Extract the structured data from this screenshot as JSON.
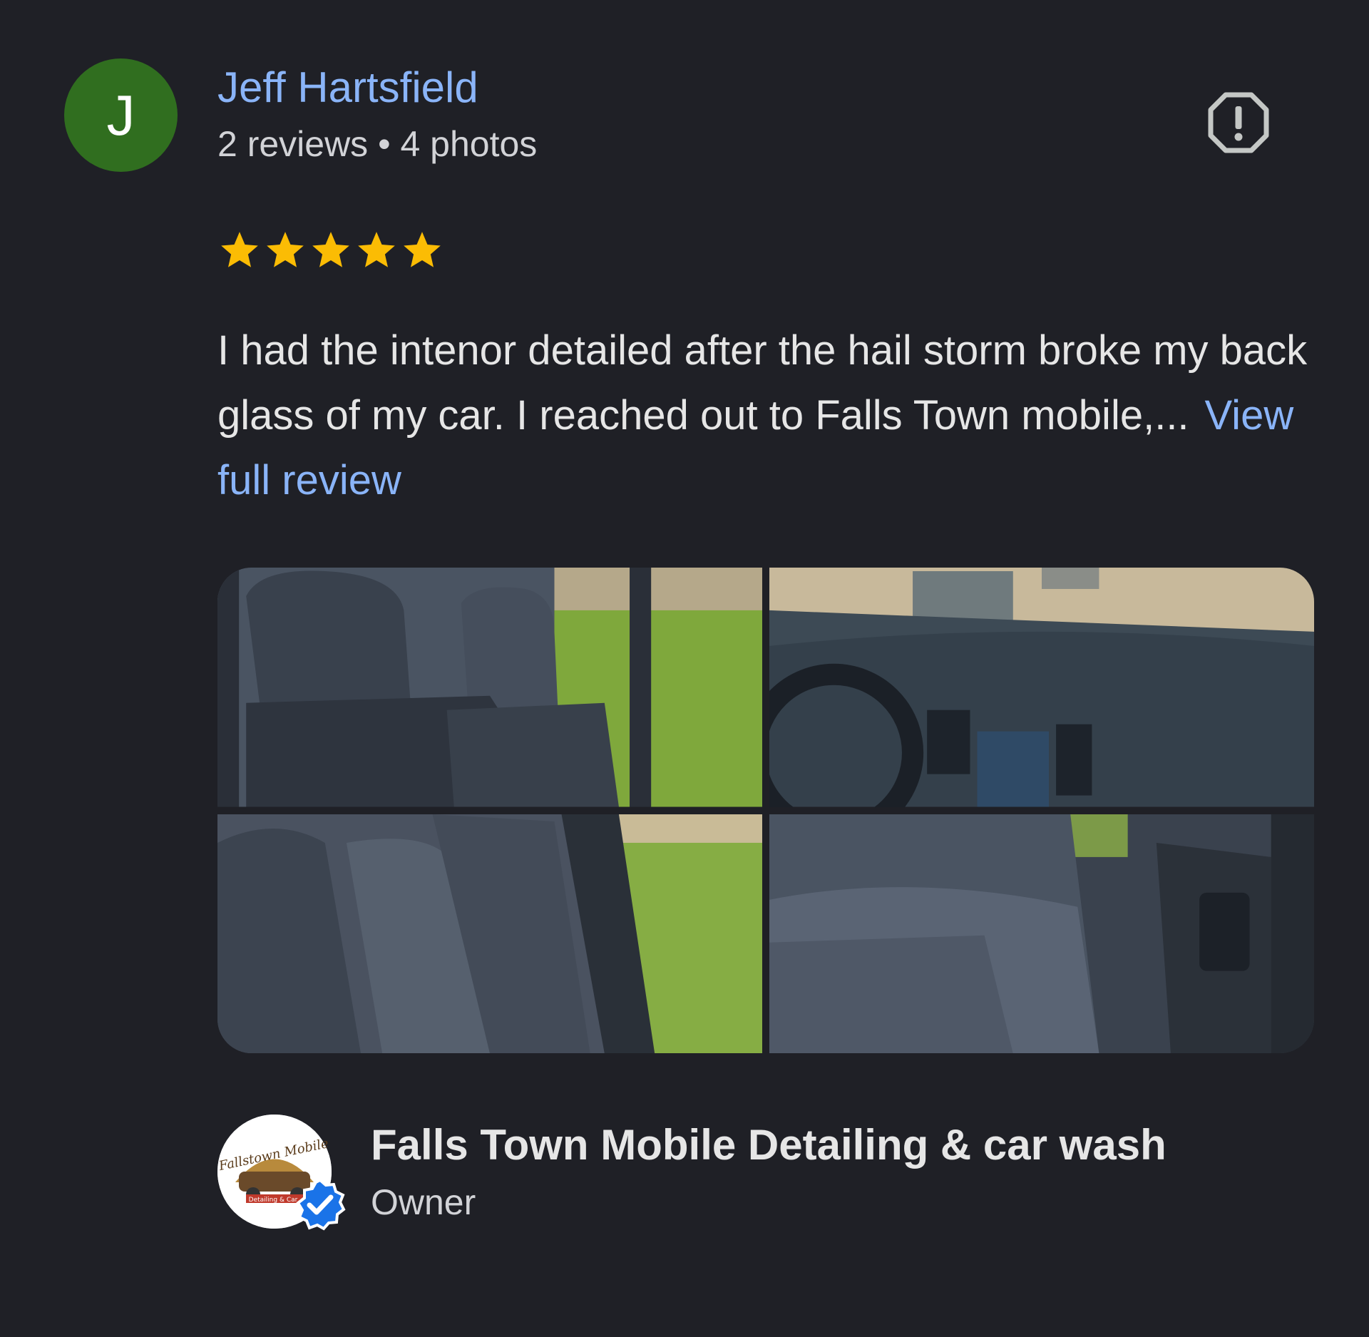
{
  "reviewer": {
    "avatar_letter": "J",
    "name": "Jeff Hartsfield",
    "meta": "2 reviews • 4 photos"
  },
  "rating": {
    "stars": 5,
    "max": 5,
    "color": "#fbbc04"
  },
  "review": {
    "text": "I had the intenor detailed after the hail storm broke my back glass of my car. I reached out to Falls Town mobile,...",
    "view_full_label": "View full review"
  },
  "photos": [
    {
      "icon": "photo-car-rear-seats"
    },
    {
      "icon": "photo-car-dashboard"
    },
    {
      "icon": "photo-car-back-seat-side"
    },
    {
      "icon": "photo-car-front-seat"
    }
  ],
  "owner": {
    "name": "Falls Town Mobile Detailing & car wash",
    "role": "Owner",
    "logo_text": "Fallstown Mobile",
    "logo_subtext": "Detailing & Car",
    "verified_color": "#1a73e8"
  },
  "colors": {
    "background": "#1f2026",
    "link": "#8ab4f8",
    "avatar": "#306e1f"
  }
}
